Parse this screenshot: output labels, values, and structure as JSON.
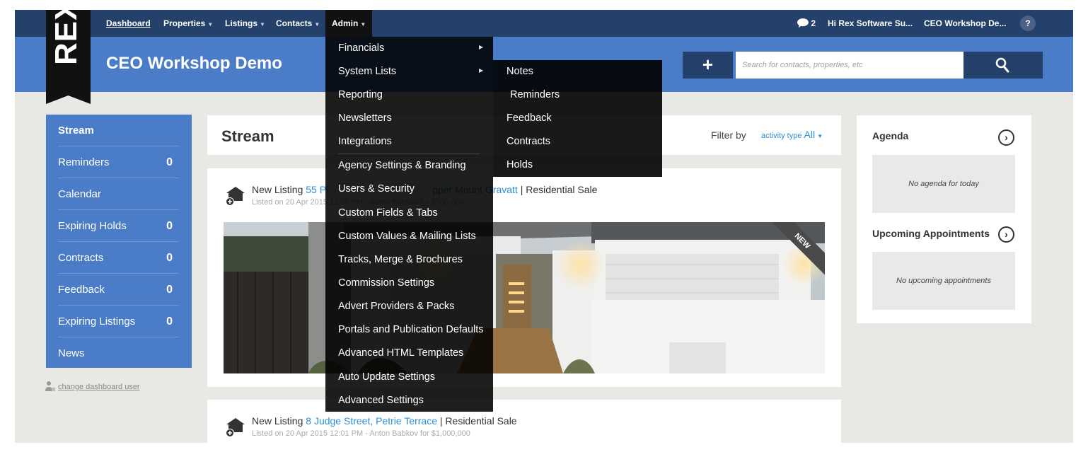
{
  "nav": {
    "items": [
      {
        "label": "Dashboard"
      },
      {
        "label": "Properties"
      },
      {
        "label": "Listings"
      },
      {
        "label": "Contacts"
      },
      {
        "label": "Admin"
      }
    ],
    "messages_count": "2",
    "greeting": "Hi Rex Software Su...",
    "account": "CEO Workshop De...",
    "help": "?"
  },
  "header": {
    "logo": "REX",
    "company": "CEO Workshop Demo",
    "add_label": "+",
    "search_placeholder": "Search for contacts, properties, etc"
  },
  "sidebar": {
    "items": [
      {
        "label": "Stream",
        "count": ""
      },
      {
        "label": "Reminders",
        "count": "0"
      },
      {
        "label": "Calendar",
        "count": ""
      },
      {
        "label": "Expiring Holds",
        "count": "0"
      },
      {
        "label": "Contracts",
        "count": "0"
      },
      {
        "label": "Feedback",
        "count": "0"
      },
      {
        "label": "Expiring Listings",
        "count": "0"
      },
      {
        "label": "News",
        "count": ""
      }
    ],
    "change_user": "change dashboard user"
  },
  "stream": {
    "title": "Stream",
    "filter_label": "Filter by",
    "filter_type": "activity type",
    "filter_value": "All"
  },
  "cards": [
    {
      "prefix": "New Listing",
      "address": "55 Pi... Upper Mount Gravatt",
      "address_start": "55 Pi",
      "address_end": "pper Mount Gravatt",
      "type": "| Residential Sale",
      "sub_start": "Listed on 20 Apr 2015 12:05 PM - Anton Babkov for $500,000",
      "badge": "NEW"
    },
    {
      "prefix": "New Listing",
      "address": "8 Judge Street, Petrie Terrace",
      "type": "| Residential Sale",
      "sub": "Listed on 20 Apr 2015 12:01 PM - Anton Babkov for $1,000,000"
    }
  ],
  "agenda": {
    "title": "Agenda",
    "empty": "No agenda for today",
    "appointments_title": "Upcoming Appointments",
    "appointments_empty": "No upcoming appointments"
  },
  "admin_menu": {
    "items": [
      "Financials",
      "System Lists",
      "Reporting",
      "Newsletters",
      "Integrations",
      "Agency Settings & Branding",
      "Users & Security",
      "Custom Fields & Tabs",
      "Custom Values & Mailing Lists",
      "Tracks, Merge & Brochures",
      "Commission Settings",
      "Advert Providers & Packs",
      "Portals and Publication Defaults",
      "Advanced HTML Templates",
      "Auto Update Settings",
      "Advanced Settings"
    ],
    "system_lists_submenu": [
      "Notes",
      "Reminders",
      "Feedback",
      "Contracts",
      "Holds"
    ]
  },
  "colors": {
    "nav_bg": "#24416b",
    "header_bg": "#4b7cc8",
    "link": "#2d8fd5",
    "menu_bg": "#111111"
  }
}
